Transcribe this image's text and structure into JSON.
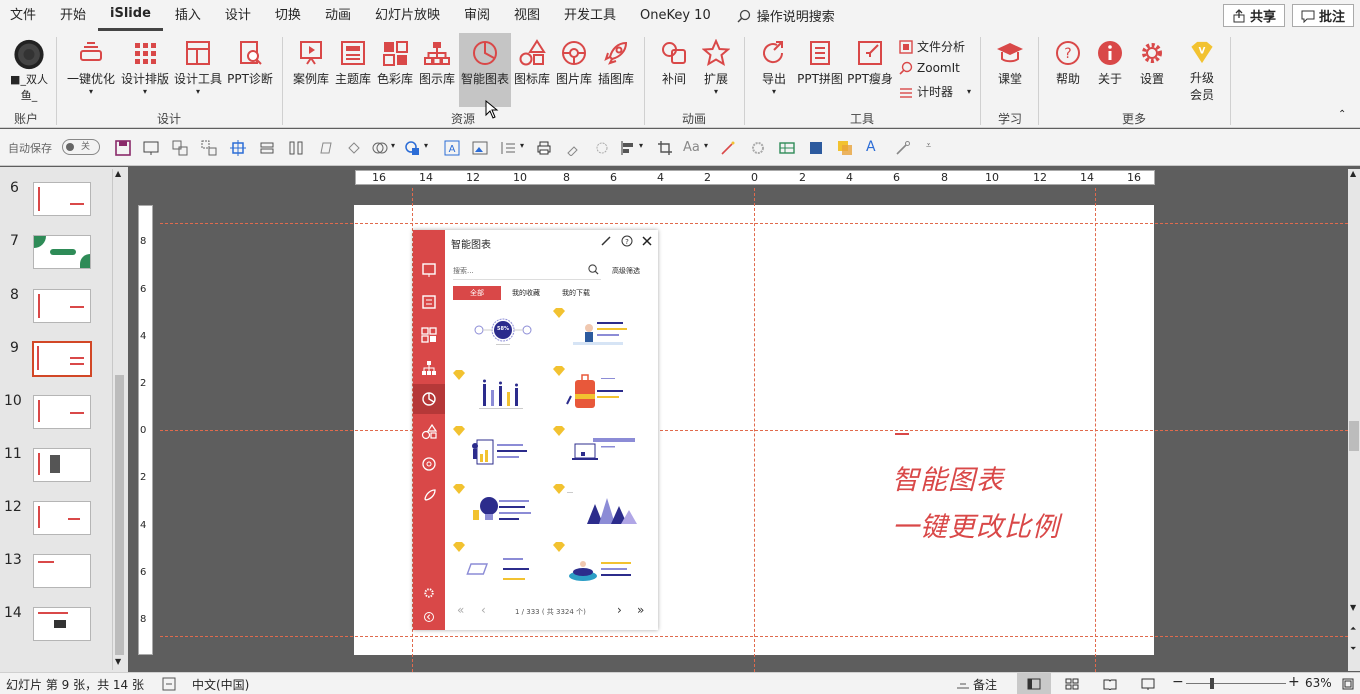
{
  "menu": {
    "items": [
      "文件",
      "开始",
      "iSlide",
      "插入",
      "设计",
      "切换",
      "动画",
      "幻灯片放映",
      "审阅",
      "视图",
      "开发工具",
      "OneKey 10"
    ],
    "search": "操作说明搜索",
    "share": "共享",
    "comment": "批注"
  },
  "ribbon": {
    "account": {
      "name_line1": "■_双人",
      "name_line2": "鱼_",
      "group": "账户"
    },
    "design": {
      "items": [
        "一键优化",
        "设计排版",
        "设计工具",
        "PPT诊断"
      ],
      "group": "设计"
    },
    "resource": {
      "items": [
        "案例库",
        "主题库",
        "色彩库",
        "图示库",
        "智能图表",
        "图标库",
        "图片库",
        "插图库"
      ],
      "group": "资源"
    },
    "animation": {
      "items": [
        "补间",
        "扩展"
      ],
      "group": "动画"
    },
    "tools": {
      "items": [
        "导出",
        "PPT拼图",
        "PPT瘦身"
      ],
      "small": [
        "文件分析",
        "ZoomIt",
        "计时器"
      ],
      "group": "工具"
    },
    "learn": {
      "items": [
        "课堂"
      ],
      "group": "学习"
    },
    "more": {
      "items": [
        "帮助",
        "关于",
        "设置"
      ],
      "upgrade_line1": "升级",
      "upgrade_line2": "会员",
      "group": "更多"
    }
  },
  "qat": {
    "autosave": "自动保存",
    "autosave_state": "关"
  },
  "thumbnails": [
    {
      "num": "6"
    },
    {
      "num": "7"
    },
    {
      "num": "8"
    },
    {
      "num": "9"
    },
    {
      "num": "10"
    },
    {
      "num": "11"
    },
    {
      "num": "12"
    },
    {
      "num": "13"
    },
    {
      "num": "14"
    }
  ],
  "ruler": {
    "h": [
      "16",
      "14",
      "12",
      "10",
      "8",
      "6",
      "4",
      "2",
      "0",
      "2",
      "4",
      "6",
      "8",
      "10",
      "12",
      "14",
      "16"
    ],
    "v": [
      "8",
      "6",
      "4",
      "2",
      "0",
      "2",
      "4",
      "6",
      "8"
    ]
  },
  "panel": {
    "title": "智能图表",
    "search_placeholder": "搜索...",
    "advanced": "高级筛选",
    "tabs": [
      "全部",
      "我的收藏",
      "我的下载"
    ],
    "pager": "1 / 333 ( 共 3324 个)",
    "item1_label": "58%"
  },
  "slide": {
    "title": "智能图表",
    "subtitle": "一键更改比例"
  },
  "status": {
    "slide_info": "幻灯片 第 9 张，共 14 张",
    "language": "中文(中国)",
    "notes": "备注",
    "zoom": "63%"
  },
  "colors": {
    "accent": "#d94848",
    "guide": "#e06a4d",
    "gold": "#f2c230",
    "navy": "#2c2c8c"
  }
}
